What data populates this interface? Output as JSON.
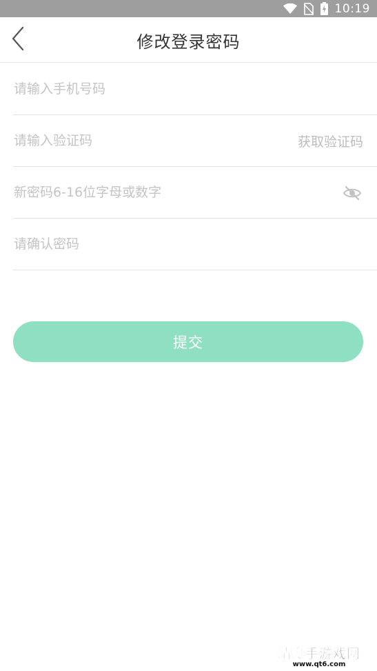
{
  "status_bar": {
    "time": "10:19",
    "icons": [
      "wifi-icon",
      "no-sim-icon",
      "battery-charging-icon"
    ]
  },
  "header": {
    "title": "修改登录密码",
    "back_icon": "chevron-left-icon"
  },
  "form": {
    "phone": {
      "placeholder": "请输入手机号码",
      "value": ""
    },
    "code": {
      "placeholder": "请输入验证码",
      "value": "",
      "get_code_label": "获取验证码"
    },
    "new_password": {
      "placeholder": "新密码6-16位字母或数字",
      "value": "",
      "toggle_icon": "eye-off-icon"
    },
    "confirm_password": {
      "placeholder": "请确认密码",
      "value": ""
    },
    "submit_label": "提交"
  },
  "watermark": {
    "title": "蜻蜓手游戏网",
    "url": "www.qt6.com"
  },
  "colors": {
    "status_bar": "#9e9e9e",
    "accent": "#8fe0c2",
    "title_text": "#333333",
    "placeholder": "#c4c4c4",
    "divider": "#e3e3e3"
  }
}
